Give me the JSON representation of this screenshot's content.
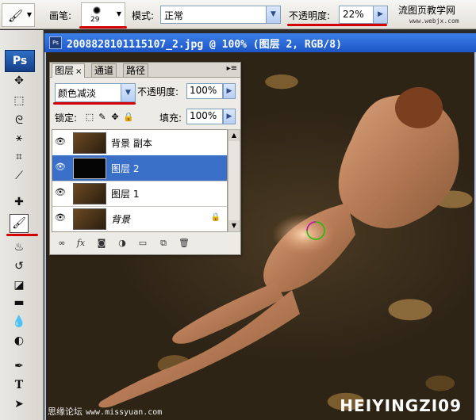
{
  "options_bar": {
    "tool_icon": "brush-icon",
    "brush_label": "画笔:",
    "brush_size": "29",
    "mode_label": "模式:",
    "mode_value": "正常",
    "opacity_label": "不透明度:",
    "opacity_value": "22%",
    "site_badge": "流图页教学网",
    "site_url": "www.webjx.com"
  },
  "toolbox": {
    "logo": "Ps",
    "tools": [
      "move-tool-icon",
      "marquee-tool-icon",
      "lasso-tool-icon",
      "magic-wand-tool-icon",
      "crop-tool-icon",
      "slice-tool-icon",
      "healing-brush-tool-icon",
      "brush-tool-icon",
      "clone-stamp-tool-icon",
      "history-brush-tool-icon",
      "eraser-tool-icon",
      "gradient-tool-icon",
      "blur-tool-icon",
      "dodge-tool-icon",
      "pen-tool-icon",
      "type-tool-icon",
      "path-selection-tool-icon"
    ],
    "active_tool": "brush-tool-icon"
  },
  "document": {
    "title": "2008828101115107_2.jpg @ 100% (图层 2, RGB/8)",
    "watermark_left": "思缘论坛",
    "watermark_url": "www.missyuan.com",
    "watermark_right": "HEIYINGZI09"
  },
  "layers_panel": {
    "tabs": [
      {
        "label": "图层",
        "active": true
      },
      {
        "label": "通道",
        "active": false
      },
      {
        "label": "路径",
        "active": false
      }
    ],
    "blend_mode": "颜色减淡",
    "opacity_label": "不透明度:",
    "opacity_value": "100%",
    "lock_label": "锁定:",
    "fill_label": "填充:",
    "fill_value": "100%",
    "layers": [
      {
        "name": "背景 副本",
        "visible": true,
        "selected": false,
        "locked": false
      },
      {
        "name": "图层 2",
        "visible": true,
        "selected": true,
        "locked": false
      },
      {
        "name": "图层 1",
        "visible": true,
        "selected": false,
        "locked": false
      },
      {
        "name": "背景",
        "visible": true,
        "selected": false,
        "locked": true
      }
    ]
  },
  "colors": {
    "highlight_red": "#d40000",
    "selection_blue": "#3a6fc8",
    "title_bar_blue": "#1d56c6"
  }
}
